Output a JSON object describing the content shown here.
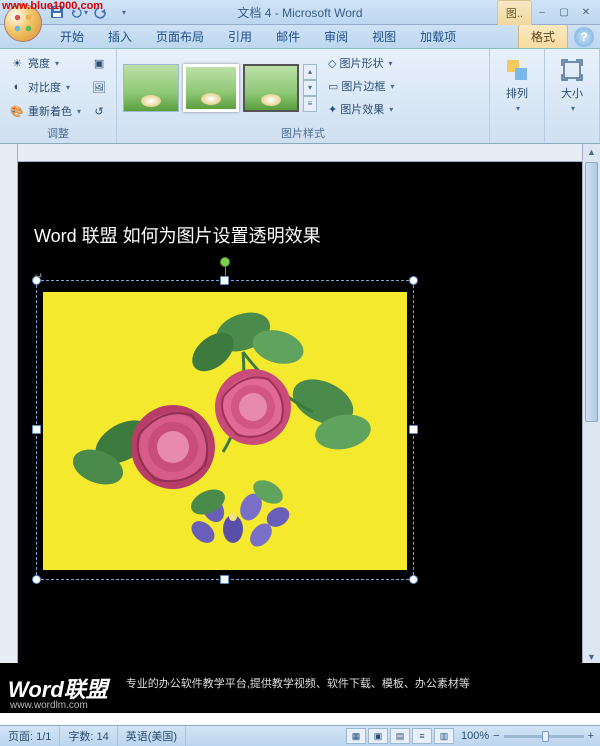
{
  "watermark": "www.blue1000.com",
  "qat": {
    "save": "保存",
    "undo": "撤销",
    "redo": "恢复"
  },
  "title": "文档 4 - Microsoft Word",
  "context_tab_group": "图..",
  "tabs": {
    "home": "开始",
    "insert": "插入",
    "layout": "页面布局",
    "references": "引用",
    "mailings": "邮件",
    "review": "审阅",
    "view": "视图",
    "addins": "加载项",
    "format": "格式"
  },
  "ribbon": {
    "adjust": {
      "label": "调整",
      "brightness": "亮度",
      "contrast": "对比度",
      "recolor": "重新着色"
    },
    "styles": {
      "label": "图片样式",
      "shape": "图片形状",
      "border": "图片边框",
      "effects": "图片效果"
    },
    "arrange": {
      "label": "排列"
    },
    "size": {
      "label": "大小"
    }
  },
  "document": {
    "heading": "Word 联盟  如何为图片设置透明效果"
  },
  "footer": {
    "logo": "Word联盟",
    "url": "www.wordlm.com",
    "tagline": "专业的办公软件教学平台,提供教学视频、软件下载、模板、办公素材等"
  },
  "status": {
    "page": "页面: 1/1",
    "words": "字数: 14",
    "lang": "英语(美国)",
    "zoom": "100%"
  }
}
